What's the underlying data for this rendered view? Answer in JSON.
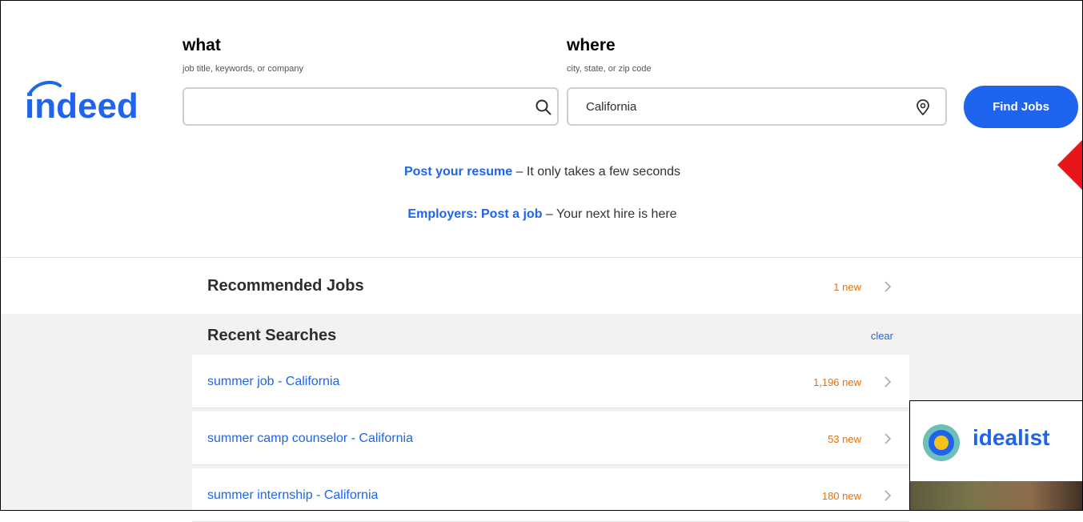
{
  "brand": {
    "name": "indeed"
  },
  "search": {
    "what": {
      "title": "what",
      "hint": "job title, keywords, or company",
      "value": ""
    },
    "where": {
      "title": "where",
      "hint": "city, state, or zip code",
      "value": "California"
    },
    "button": "Find Jobs"
  },
  "promos": [
    {
      "link": "Post your resume",
      "text": " – It only takes a few seconds"
    },
    {
      "link": "Employers: Post a job",
      "text": " – Your next hire is here"
    }
  ],
  "recommended": {
    "title": "Recommended Jobs",
    "count": "1 new"
  },
  "recent": {
    "title": "Recent Searches",
    "clear": "clear",
    "items": [
      {
        "label": "summer job - California",
        "count": "1,196 new"
      },
      {
        "label": "summer camp counselor - California",
        "count": "53 new"
      },
      {
        "label": "summer internship - California",
        "count": "180 new"
      }
    ]
  },
  "ad": {
    "brand": "idealist"
  },
  "colors": {
    "accent": "#1f64ec",
    "new_badge": "#e8710a",
    "annotation_arrow": "#e8161b"
  }
}
